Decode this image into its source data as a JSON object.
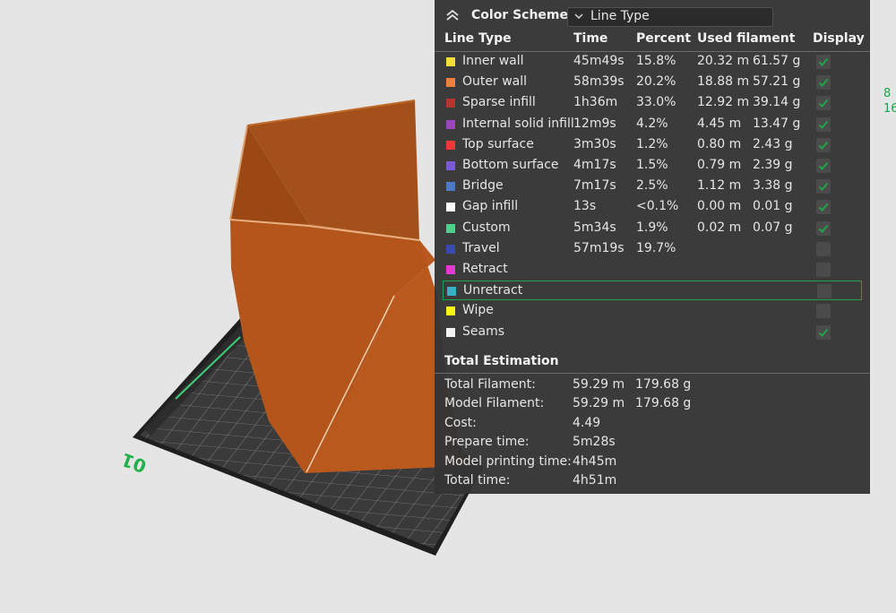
{
  "viewport": {
    "bed_label": "01",
    "side_readout": [
      "8",
      "16"
    ]
  },
  "panel": {
    "title": "Color Scheme",
    "scheme_value": "Line Type",
    "columns": {
      "line_type": "Line Type",
      "time": "Time",
      "percent": "Percent",
      "used_filament": "Used filament",
      "display": "Display"
    },
    "rows": [
      {
        "name": "Inner wall",
        "color": "#f4dc3a",
        "time": "45m49s",
        "percent": "15.8%",
        "length": "20.32 m",
        "weight": "61.57 g",
        "display": true,
        "highlight": false
      },
      {
        "name": "Outer wall",
        "color": "#f0803a",
        "time": "58m39s",
        "percent": "20.2%",
        "length": "18.88 m",
        "weight": "57.21 g",
        "display": true,
        "highlight": false
      },
      {
        "name": "Sparse infill",
        "color": "#b8322e",
        "time": "1h36m",
        "percent": "33.0%",
        "length": "12.92 m",
        "weight": "39.14 g",
        "display": true,
        "highlight": false
      },
      {
        "name": "Internal solid infill",
        "color": "#9a46c4",
        "time": "12m9s",
        "percent": "4.2%",
        "length": "4.45 m",
        "weight": "13.47 g",
        "display": true,
        "highlight": false
      },
      {
        "name": "Top surface",
        "color": "#f03a3a",
        "time": "3m30s",
        "percent": "1.2%",
        "length": "0.80 m",
        "weight": "2.43 g",
        "display": true,
        "highlight": false
      },
      {
        "name": "Bottom surface",
        "color": "#7a5ad6",
        "time": "4m17s",
        "percent": "1.5%",
        "length": "0.79 m",
        "weight": "2.39 g",
        "display": true,
        "highlight": false
      },
      {
        "name": "Bridge",
        "color": "#4a7ac8",
        "time": "7m17s",
        "percent": "2.5%",
        "length": "1.12 m",
        "weight": "3.38 g",
        "display": true,
        "highlight": false
      },
      {
        "name": "Gap infill",
        "color": "#ffffff",
        "time": "13s",
        "percent": "<0.1%",
        "length": "0.00 m",
        "weight": "0.01 g",
        "display": true,
        "highlight": false
      },
      {
        "name": "Custom",
        "color": "#4ed08a",
        "time": "5m34s",
        "percent": "1.9%",
        "length": "0.02 m",
        "weight": "0.07 g",
        "display": true,
        "highlight": false
      },
      {
        "name": "Travel",
        "color": "#3a48b8",
        "time": "57m19s",
        "percent": "19.7%",
        "length": "",
        "weight": "",
        "display": false,
        "highlight": false
      },
      {
        "name": "Retract",
        "color": "#e03ad8",
        "time": "",
        "percent": "",
        "length": "",
        "weight": "",
        "display": false,
        "highlight": false
      },
      {
        "name": "Unretract",
        "color": "#3ab0c8",
        "time": "",
        "percent": "",
        "length": "",
        "weight": "",
        "display": false,
        "highlight": true
      },
      {
        "name": "Wipe",
        "color": "#f5f51a",
        "time": "",
        "percent": "",
        "length": "",
        "weight": "",
        "display": false,
        "highlight": false
      },
      {
        "name": "Seams",
        "color": "#f2f2f2",
        "time": "",
        "percent": "",
        "length": "",
        "weight": "",
        "display": true,
        "highlight": false
      }
    ],
    "total_title": "Total Estimation",
    "totals": [
      {
        "label": "Total Filament:",
        "v1": "59.29 m",
        "v2": "179.68 g"
      },
      {
        "label": "Model Filament:",
        "v1": "59.29 m",
        "v2": "179.68 g"
      },
      {
        "label": "Cost:",
        "v1": "4.49",
        "v2": ""
      },
      {
        "label": "Prepare time:",
        "v1": "5m28s",
        "v2": ""
      },
      {
        "label": "Model printing time:",
        "v1": "4h45m",
        "v2": ""
      },
      {
        "label": "Total time:",
        "v1": "4h51m",
        "v2": ""
      }
    ]
  },
  "colors": {
    "accent_green": "#1fa44a",
    "model_orange": "#b4561c"
  }
}
